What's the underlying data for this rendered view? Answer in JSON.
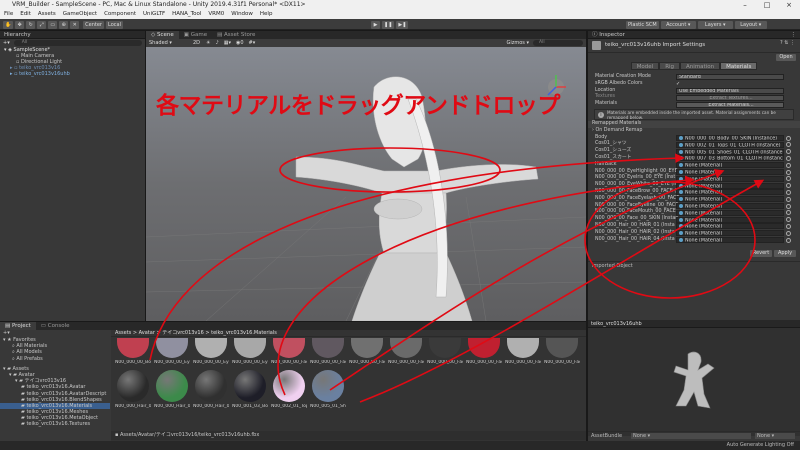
{
  "titlebar": {
    "title": "VRM_Builder - SampleScene - PC, Mac & Linux Standalone - Unity 2019.4.31f1 Personal* <DX11>"
  },
  "menu": [
    "File",
    "Edit",
    "Assets",
    "GameObject",
    "Component",
    "UniGLTF",
    "HANA_Tool",
    "VRM0",
    "Window",
    "Help"
  ],
  "toolbar": {
    "center": "Center",
    "local": "Local",
    "plastic": "Plastic SCM",
    "account": "Account",
    "layers": "Layers",
    "layout": "Layout"
  },
  "hierarchy": {
    "title": "Hierarchy",
    "search": "All",
    "items": [
      "SampleScene*",
      "Main Camera",
      "Directional Light",
      "teiko_vrc013v16",
      "teiko_vrc013v16uhb"
    ]
  },
  "scene": {
    "tabs": [
      "Scene",
      "Game",
      "Asset Store"
    ],
    "shading": "Shaded",
    "mode2d": "2D",
    "gizmos": "Gizmos",
    "search": "All",
    "annotation": "各マテリアルをドラッグアンドドロップ"
  },
  "inspector": {
    "title": "Inspector",
    "asset_name": "teiko_vrc013v16uhb Import Settings",
    "open": "Open",
    "tabs": [
      "Model",
      "Rig",
      "Animation",
      "Materials"
    ],
    "creation_mode_label": "Material Creation Mode",
    "creation_mode_value": "Standard",
    "albedo_label": "sRGB Albedo Colors",
    "location_label": "Location",
    "location_value": "Use Embedded Materials",
    "textures_label": "Textures",
    "textures_button": "Extract Textures...",
    "materials_label": "Materials",
    "materials_button": "Extract Materials...",
    "info": "Materials are embedded inside the imported asset. Material assignments can be remapped below.",
    "remapped": "Remapped Materials",
    "on_demand": "On Demand Remap",
    "rows": [
      {
        "label": "Body",
        "value": "N00_000_00_Body_00_SKIN (Instance)"
      },
      {
        "label": "Cos01_シャツ",
        "value": "N00_002_01_Tops_01_CLOTH (Instance)"
      },
      {
        "label": "Cos01_シューズ",
        "value": "N00_005_01_Shoes_01_CLOTH (Instance)"
      },
      {
        "label": "Cos01_スカート",
        "value": "N00_007_03_Bottom_01_CLOTH (Instance)"
      },
      {
        "label": "HairBack",
        "value": "None (Material)"
      },
      {
        "label": "N00_000_00_EyeHighlight_00_EYE",
        "value": "None (Material)"
      },
      {
        "label": "N00_000_00_EyeIris_00_EYE (Inst",
        "value": "None (Material)"
      },
      {
        "label": "N00_000_00_EyeWhite_00_EYE (Ins",
        "value": "None (Material)"
      },
      {
        "label": "N00_000_00_FaceBrow_00_FACE (In",
        "value": "None (Material)"
      },
      {
        "label": "N00_000_00_FaceEyelash_00_FACE",
        "value": "None (Material)"
      },
      {
        "label": "N00_000_00_FaceEyeline_00_FACE",
        "value": "None (Material)"
      },
      {
        "label": "N00_000_00_FaceMouth_00_FACE",
        "value": "None (Material)"
      },
      {
        "label": "N00_000_00_Face_00_SKIN (Instan",
        "value": "None (Material)"
      },
      {
        "label": "N00_000_Hair_00_HAIR_01 (Insta",
        "value": "None (Material)"
      },
      {
        "label": "N00_000_Hair_00_HAIR_02 (Insta",
        "value": "None (Material)"
      },
      {
        "label": "N00_000_Hair_00_HAIR_04 (Insta",
        "value": "None (Material)"
      }
    ],
    "revert": "Revert",
    "apply": "Apply",
    "imported_object": "Imported Object",
    "preview_name": "teiko_vrc013v16uhb",
    "asset_bundle_label": "AssetBundle",
    "asset_bundle_value": "None",
    "asset_bundle_variant": "None"
  },
  "project": {
    "tabs": [
      "Project",
      "Console"
    ],
    "favorites": "Favorites",
    "fav_items": [
      "All Materials",
      "All Models",
      "All Prefabs"
    ],
    "tree": [
      "Assets",
      "Avatar",
      "テイコvrc013v16",
      "teiko_vrc013v16.Avatar",
      "teiko_vrc013v16.AvatarDescript",
      "teiko_vrc013v16.BlendShapes",
      "teiko_vrc013v16.Materials",
      "teiko_vrc013v16.Meshes",
      "teiko_vrc013v16.MetaObject",
      "teiko_vrc013v16.Textures"
    ],
    "breadcrumb": "Assets > Avatar > テイコvrc013v16 > teiko_vrc013v16.Materials",
    "row1": [
      "N00_000_00_Bod...",
      "N00_000_00_Eye...",
      "N00_000_00_Eye...",
      "N00_000_00_Eye...",
      "N00_000_00_Fac...",
      "N00_000_00_Fac...",
      "N00_000_00_Fac...",
      "N00_000_00_Fac...",
      "N00_000_00_Fac...",
      "N00_000_00_Fac...",
      "N00_000_00_Fac...",
      "N00_000_00_Fac..."
    ],
    "row2": [
      "N00_000_Hair_00...",
      "N00_000_Hair_00...",
      "N00_000_Hair_00...",
      "N00_001_03_Bott...",
      "N00_002_01_Top...",
      "N00_005_01_Sho..."
    ],
    "footer_path": "Assets/Avatar/テイコvrc013v16/teiko_vrc013v16uhb.fbx"
  },
  "status": {
    "text": "Auto Generate Lighting Off"
  },
  "colors": {
    "annotation": "#e00a14",
    "accent": "#3a5f8f"
  }
}
